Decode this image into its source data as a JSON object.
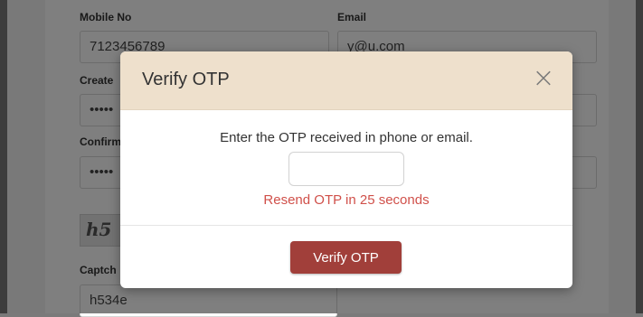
{
  "form": {
    "mobile_label": "Mobile No",
    "mobile_value": "7123456789",
    "email_label": "Email",
    "email_value": "y@u.com",
    "create_label": "Create",
    "create_value": "•••••",
    "confirm_label": "Confirm",
    "confirm_value": "•••••",
    "captcha_image_text": "h5",
    "captcha_label": "Captch",
    "captcha_value": "h534e"
  },
  "modal": {
    "title": "Verify OTP",
    "close_icon": "close-icon",
    "prompt": "Enter the OTP received in phone or email.",
    "otp_value": "",
    "resend_text": "Resend OTP in 25 seconds",
    "verify_label": "Verify OTP"
  },
  "colors": {
    "header_bg": "#eee0cc",
    "verify_button": "#a13f3a",
    "resend_text": "#d0504a"
  }
}
